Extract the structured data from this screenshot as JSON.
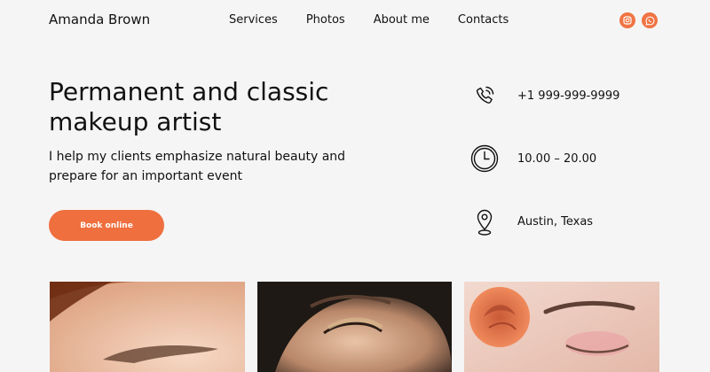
{
  "header": {
    "brand": "Amanda Brown",
    "nav": [
      "Services",
      "Photos",
      "About me",
      "Contacts"
    ],
    "socials": [
      "instagram-icon",
      "whatsapp-icon"
    ]
  },
  "hero": {
    "title_line1": "Permanent and classic",
    "title_line2": "makeup artist",
    "subtitle_line1": "I help my clients emphasize natural beauty and",
    "subtitle_line2": "prepare for an important event",
    "cta": "Book online"
  },
  "contacts": {
    "phone": "+1 999-999-9999",
    "hours": "10.00 – 20.00",
    "location": "Austin, Texas"
  },
  "gallery": {
    "photos": [
      "eyebrow-closeup-photo",
      "eye-makeup-closeup-photo",
      "rose-and-face-photo"
    ]
  },
  "colors": {
    "accent": "#ef6f3e",
    "background": "#f5f5f5"
  }
}
